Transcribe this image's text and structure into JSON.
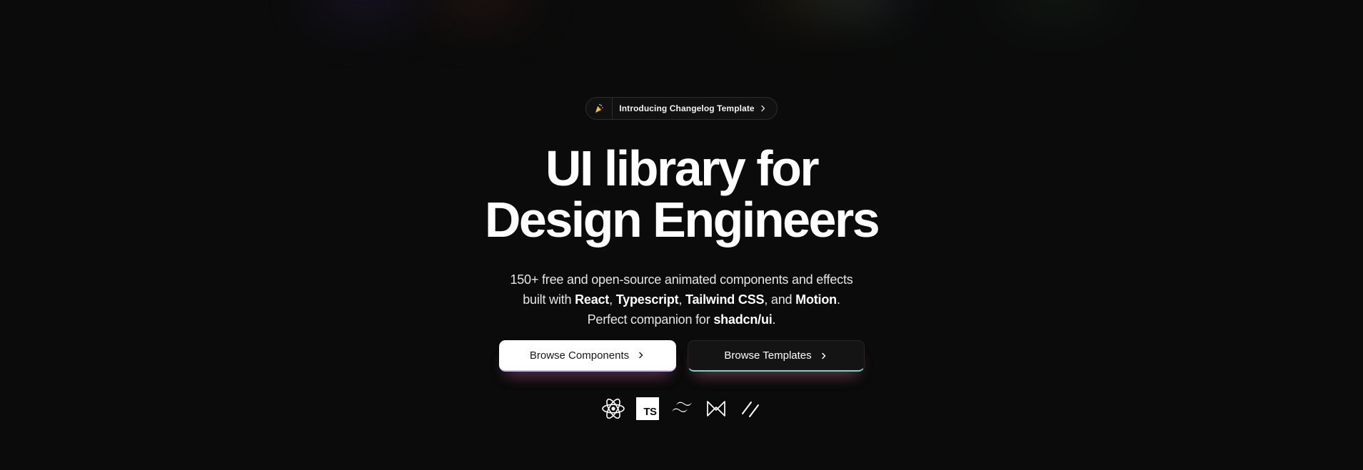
{
  "announcement": {
    "icon": "party-popper-icon",
    "text": "Introducing Changelog Template"
  },
  "hero": {
    "title_line1": "UI library for",
    "title_line2": "Design Engineers",
    "subtitle": {
      "line1": "150+ free and open-source animated components and effects",
      "line2_prefix": "built with ",
      "react": "React",
      "comma1": ", ",
      "typescript": "Typescript",
      "comma2": ", ",
      "tailwind": "Tailwind CSS",
      "and": ", and ",
      "motion": "Motion",
      "period1": ".",
      "line3_prefix": "Perfect companion for ",
      "shadcn": "shadcn/ui",
      "period2": "."
    }
  },
  "buttons": {
    "primary_label": "Browse Components",
    "secondary_label": "Browse Templates"
  },
  "tech_icons": {
    "react": "react-logo-icon",
    "typescript_text": "TS",
    "tailwind": "tailwind-logo-icon",
    "motion": "motion-logo-icon",
    "shadcn": "shadcn-logo-icon"
  },
  "colors": {
    "background": "#0b0b0b",
    "primary_button_bg": "#ffffff",
    "secondary_button_bg": "#141414",
    "text": "#ffffff"
  }
}
